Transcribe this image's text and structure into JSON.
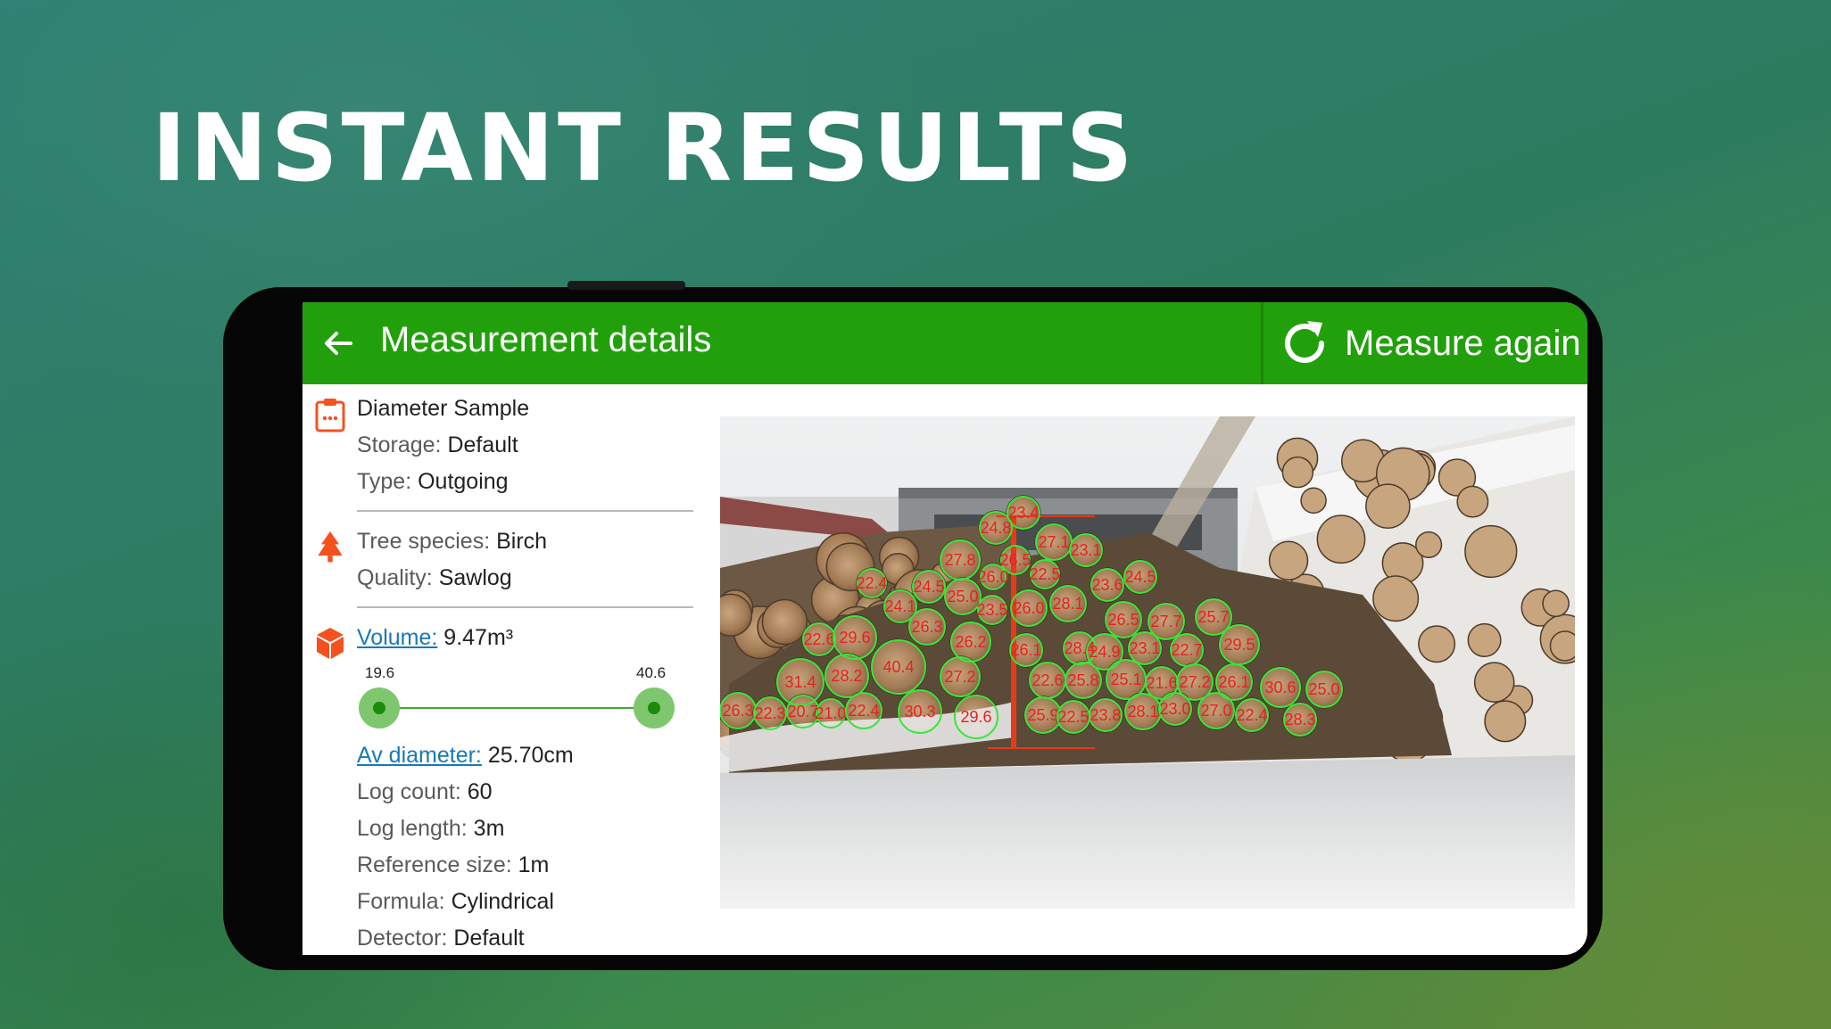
{
  "headline": "INSTANT RESULTS",
  "appbar": {
    "title": "Measurement details",
    "measure_again": "Measure again"
  },
  "sample": {
    "name": "Diameter Sample",
    "storage_key": "Storage:",
    "storage_val": "Default",
    "type_key": "Type:",
    "type_val": "Outgoing"
  },
  "tree": {
    "species_key": "Tree species:",
    "species_val": "Birch",
    "quality_key": "Quality:",
    "quality_val": "Sawlog"
  },
  "volume": {
    "link": "Volume:",
    "value": "9.47m³",
    "range_min": "19.6",
    "range_max": "40.6",
    "avdiam_link": "Av diameter:",
    "avdiam_value": "25.70cm",
    "logcount_key": "Log count:",
    "logcount_val": "60",
    "loglength_key": "Log length:",
    "loglength_val": "3m",
    "refsize_key": "Reference size:",
    "refsize_val": "1m",
    "formula_key": "Formula:",
    "formula_val": "Cylindrical",
    "detector_key": "Detector:",
    "detector_val": "Default"
  },
  "log_labels": [
    "23.4",
    "24.8",
    "27.1",
    "23.1",
    "27.8",
    "26.5",
    "26.0",
    "22.5",
    "22.4",
    "24.5",
    "25.0",
    "23.6",
    "24.5",
    "24.1",
    "23.5",
    "26.0",
    "28.1",
    "26.3",
    "26.2",
    "26.5",
    "27.7",
    "25.7",
    "22.6",
    "29.6",
    "28.4",
    "26.1",
    "24.9",
    "23.1",
    "22.7",
    "29.5",
    "40.4",
    "31.4",
    "28.2",
    "27.2",
    "22.6",
    "25.8",
    "25.1",
    "21.6",
    "27.2",
    "26.1",
    "30.6",
    "25.0",
    "26.3",
    "22.3",
    "20.7",
    "21.0",
    "22.4",
    "30.3",
    "29.6",
    "25.9",
    "22.5",
    "23.8",
    "28.1",
    "23.0",
    "27.0",
    "22.4",
    "28.3"
  ],
  "colors": {
    "appbar": "#22a00b",
    "accent": "#f4511e",
    "circle": "#39e639",
    "label": "#e52222"
  },
  "icons": {
    "back": "arrow-left-icon",
    "refresh": "refresh-icon",
    "sample": "clipboard-icon",
    "tree": "tree-icon",
    "volume": "cube-icon",
    "chat": "chat-icon"
  }
}
